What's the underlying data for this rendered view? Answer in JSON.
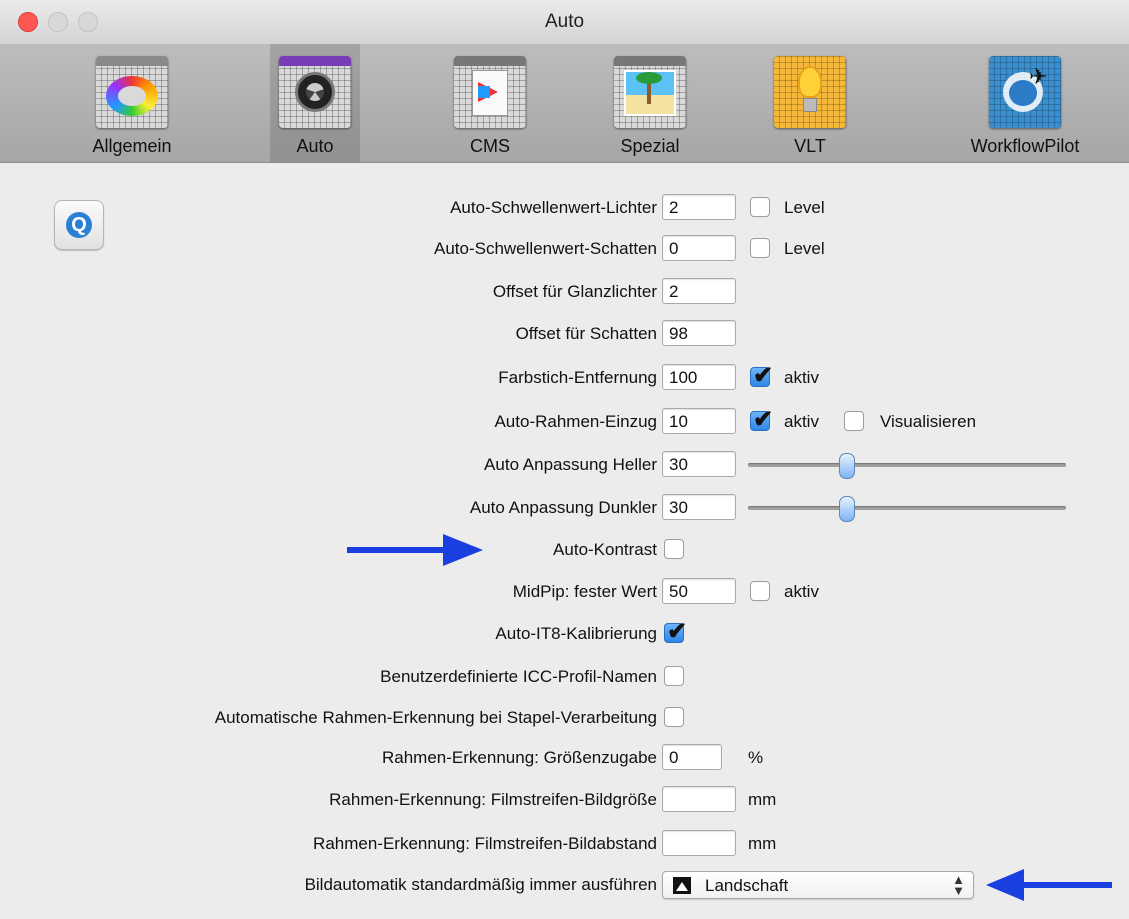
{
  "window": {
    "title": "Auto"
  },
  "toolbar": {
    "tabs": [
      {
        "label": "Allgemein",
        "icon": "color-wheel-icon"
      },
      {
        "label": "Auto",
        "icon": "aperture-icon",
        "selected": true
      },
      {
        "label": "CMS",
        "icon": "color-profile-icon"
      },
      {
        "label": "Spezial",
        "icon": "beach-palm-icon"
      },
      {
        "label": "VLT",
        "icon": "light-bulb-icon"
      },
      {
        "label": "WorkflowPilot",
        "icon": "pilot-plane-icon"
      }
    ]
  },
  "help": {
    "icon": "quicktime-help-icon"
  },
  "settings": {
    "highlight_threshold": {
      "label": "Auto-Schwellenwert-Lichter",
      "value": "2",
      "checkbox_label": "Level",
      "checked": false
    },
    "shadow_threshold": {
      "label": "Auto-Schwellenwert-Schatten",
      "value": "0",
      "checkbox_label": "Level",
      "checked": false
    },
    "gloss_offset": {
      "label": "Offset für Glanzlichter",
      "value": "2"
    },
    "shadow_offset": {
      "label": "Offset für Schatten",
      "value": "98"
    },
    "cast_removal": {
      "label": "Farbstich-Entfernung",
      "value": "100",
      "checkbox_label": "aktiv",
      "checked": true
    },
    "frame_inset": {
      "label": "Auto-Rahmen-Einzug",
      "value": "10",
      "checkbox_label": "aktiv",
      "checked": true,
      "checkbox2_label": "Visualisieren",
      "checked2": false
    },
    "adjust_brighter": {
      "label": "Auto Anpassung Heller",
      "value": "30",
      "slider_fraction": 0.3
    },
    "adjust_darker": {
      "label": "Auto Anpassung Dunkler",
      "value": "30",
      "slider_fraction": 0.3
    },
    "auto_contrast": {
      "label": "Auto-Kontrast",
      "checked": false
    },
    "midpip": {
      "label": "MidPip: fester Wert",
      "value": "50",
      "checkbox_label": "aktiv",
      "checked": false
    },
    "it8": {
      "label": "Auto-IT8-Kalibrierung",
      "checked": true
    },
    "icc_names": {
      "label": "Benutzerdefinierte ICC-Profil-Namen",
      "checked": false
    },
    "batch_frame_detect": {
      "label": "Automatische Rahmen-Erkennung bei Stapel-Verarbeitung",
      "checked": false
    },
    "frame_size_add": {
      "label": "Rahmen-Erkennung: Größenzugabe",
      "value": "0",
      "unit": "%"
    },
    "film_image_size": {
      "label": "Rahmen-Erkennung: Filmstreifen-Bildgröße",
      "value": "",
      "unit": "mm"
    },
    "film_image_gap": {
      "label": "Rahmen-Erkennung: Filmstreifen-Bildabstand",
      "value": "",
      "unit": "mm"
    },
    "default_auto": {
      "label": "Bildautomatik standardmäßig immer ausführen",
      "selected": "Landschaft",
      "icon": "landscape-icon"
    }
  },
  "annotations": {
    "arrow_color": "#1a3fe0"
  }
}
